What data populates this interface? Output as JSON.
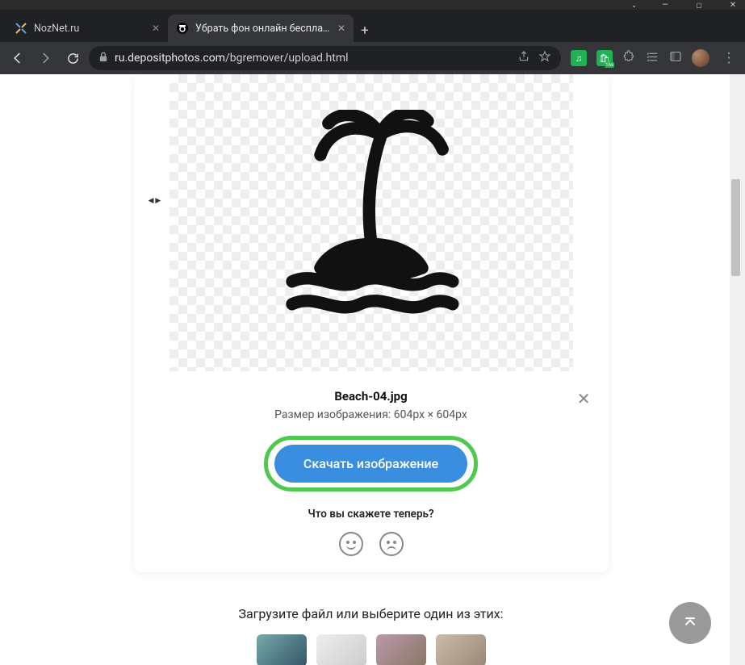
{
  "window": {
    "tabs": [
      {
        "title": "NozNet.ru",
        "active": false
      },
      {
        "title": "Убрать фон онлайн бесплатно",
        "active": true
      }
    ]
  },
  "addressbar": {
    "domain": "ru.depositphotos.com",
    "path": "/bgremover/upload.html"
  },
  "result": {
    "filename": "Beach-04.jpg",
    "dimensions": "Размер изображения: 604px × 604px",
    "download_label": "Скачать изображение",
    "feedback_question": "Что вы скажете теперь?"
  },
  "below": {
    "prompt": "Загрузите файл или выберите один из этих:"
  }
}
